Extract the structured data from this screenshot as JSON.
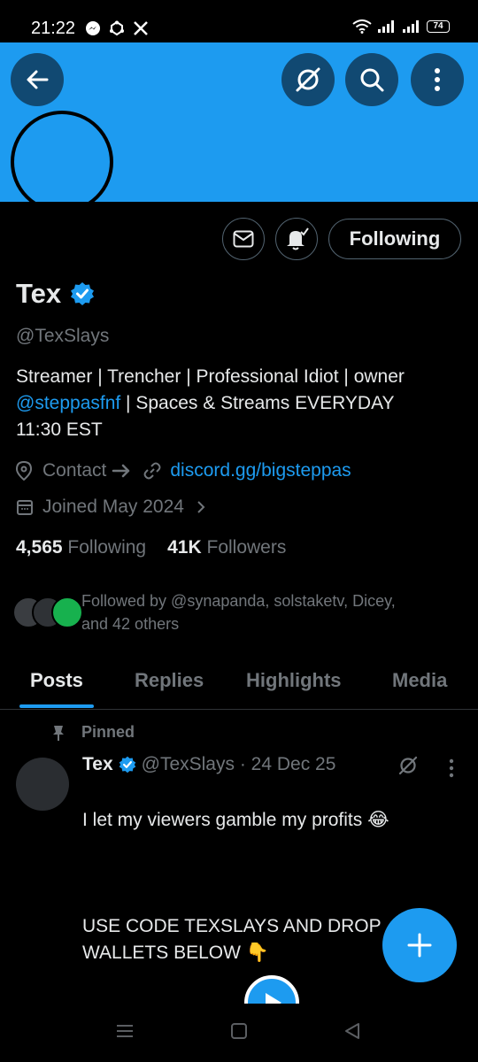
{
  "status_bar": {
    "time": "21:22",
    "battery": "74",
    "left_icons": [
      "messenger-icon",
      "sync-icon",
      "x-logo-icon"
    ],
    "right_icons": [
      "wifi-icon",
      "signal-icon",
      "signal-icon",
      "battery-icon"
    ]
  },
  "header": {
    "back_icon": "arrow-left-icon",
    "grok_icon": "grok-icon",
    "search_icon": "search-icon",
    "more_icon": "more-vertical-icon",
    "banner_color": "#1d9bf0"
  },
  "profile": {
    "name": "Tex",
    "handle": "@TexSlays",
    "bio_part1": "Streamer | Trencher | Professional Idiot | owner",
    "bio_mention": "@steppasfnf",
    "bio_part2": " | Spaces & Streams EVERYDAY",
    "bio_part3": "11:30 EST",
    "contact_label": "Contact",
    "website": "discord.gg/bigsteppas",
    "joined": "Joined May 2024",
    "following_button": "Following",
    "following_count": "4,565",
    "following_label": "Following",
    "followers_count": "41K",
    "followers_label": "Followers",
    "followed_by_line1": "Followed by @synapanda, solstaketv, Dicey,",
    "followed_by_line2": "and 42 others",
    "verified_color": "#1d9bf0"
  },
  "tabs": [
    {
      "label": "Posts",
      "active": true
    },
    {
      "label": "Replies",
      "active": false
    },
    {
      "label": "Highlights",
      "active": false
    },
    {
      "label": "Media",
      "active": false
    }
  ],
  "pinned_post": {
    "pinned_label": "Pinned",
    "author": "Tex",
    "handle_date": "@TexSlays · 24 Dec 25",
    "text_line1": "I let my viewers gamble my profits 😂",
    "text_line2": "USE CODE TEXSLAYS AND DROP\nWALLETS BELOW 👇"
  },
  "fab": {
    "icon": "plus-icon"
  },
  "nav_bar": {
    "icons": [
      "recents-icon",
      "home-icon",
      "back-icon"
    ]
  }
}
